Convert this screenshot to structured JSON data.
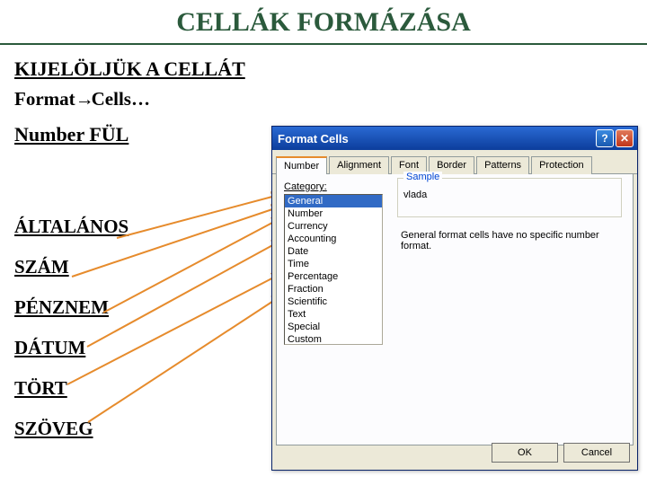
{
  "title": "CELLÁK FORMÁZÁSA",
  "subhead": "KIJELÖLJÜK A CELLÁT",
  "step_prefix": "Format",
  "step_arrow": "→",
  "step_suffix": "Cells…",
  "tab_label": "Number FÜL",
  "left_labels": [
    "ÁLTALÁNOS",
    "SZÁM",
    "PÉNZNEM",
    "DÁTUM",
    "TÖRT",
    "SZÖVEG"
  ],
  "dialog": {
    "title": "Format Cells",
    "help_glyph": "?",
    "close_glyph": "✕",
    "tabs": [
      "Number",
      "Alignment",
      "Font",
      "Border",
      "Patterns",
      "Protection"
    ],
    "active_tab": 0,
    "category_label": "Category:",
    "categories": [
      "General",
      "Number",
      "Currency",
      "Accounting",
      "Date",
      "Time",
      "Percentage",
      "Fraction",
      "Scientific",
      "Text",
      "Special",
      "Custom"
    ],
    "selected_category": 0,
    "sample_legend": "Sample",
    "sample_value": "vlada",
    "description": "General format cells have no specific number format.",
    "ok": "OK",
    "cancel": "Cancel"
  }
}
